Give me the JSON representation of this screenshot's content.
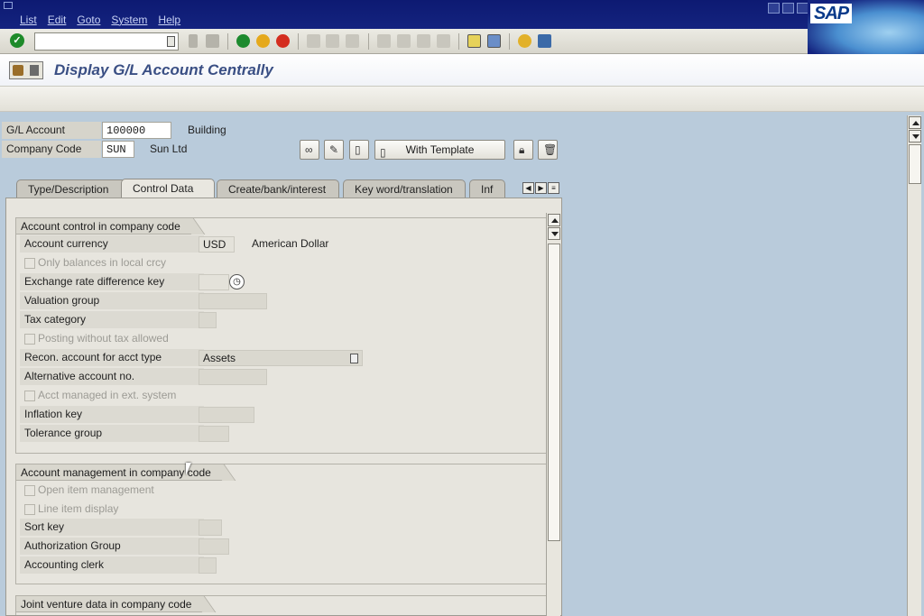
{
  "menu": {
    "items": [
      "List",
      "Edit",
      "Goto",
      "System",
      "Help"
    ]
  },
  "branding": {
    "logo_text": "SAP"
  },
  "title": "Display G/L Account Centrally",
  "header": {
    "gl_account_label": "G/L Account",
    "gl_account_value": "100000",
    "gl_account_desc": "Building",
    "company_code_label": "Company Code",
    "company_code_value": "SUN",
    "company_code_desc": "Sun Ltd"
  },
  "actions": {
    "with_template_label": "With Template"
  },
  "tabs": [
    {
      "label": "Type/Description",
      "active": false
    },
    {
      "label": "Control Data",
      "active": true
    },
    {
      "label": "Create/bank/interest",
      "active": false
    },
    {
      "label": "Key word/translation",
      "active": false
    },
    {
      "label": "Inf",
      "active": false
    }
  ],
  "account_control": {
    "title": "Account control in company code",
    "account_currency_label": "Account currency",
    "account_currency_value": "USD",
    "account_currency_desc": "American Dollar",
    "only_balances_label": "Only balances in local crcy",
    "exchange_rate_key_label": "Exchange rate difference key",
    "valuation_group_label": "Valuation group",
    "tax_category_label": "Tax category",
    "posting_without_tax_label": "Posting without tax allowed",
    "recon_account_label": "Recon. account for acct type",
    "recon_account_value": "Assets",
    "alt_account_label": "Alternative account no.",
    "acct_managed_ext_label": "Acct managed in ext. system",
    "inflation_key_label": "Inflation key",
    "tolerance_group_label": "Tolerance group"
  },
  "account_management": {
    "title": "Account management in company code",
    "open_item_label": "Open item management",
    "line_item_label": "Line item display",
    "sort_key_label": "Sort key",
    "authorization_group_label": "Authorization Group",
    "accounting_clerk_label": "Accounting clerk"
  },
  "joint_venture": {
    "title": "Joint venture data in company code"
  },
  "colors": {
    "menubar": "#14237f",
    "title_text": "#3a4f84",
    "background": "#b9cbdb"
  }
}
